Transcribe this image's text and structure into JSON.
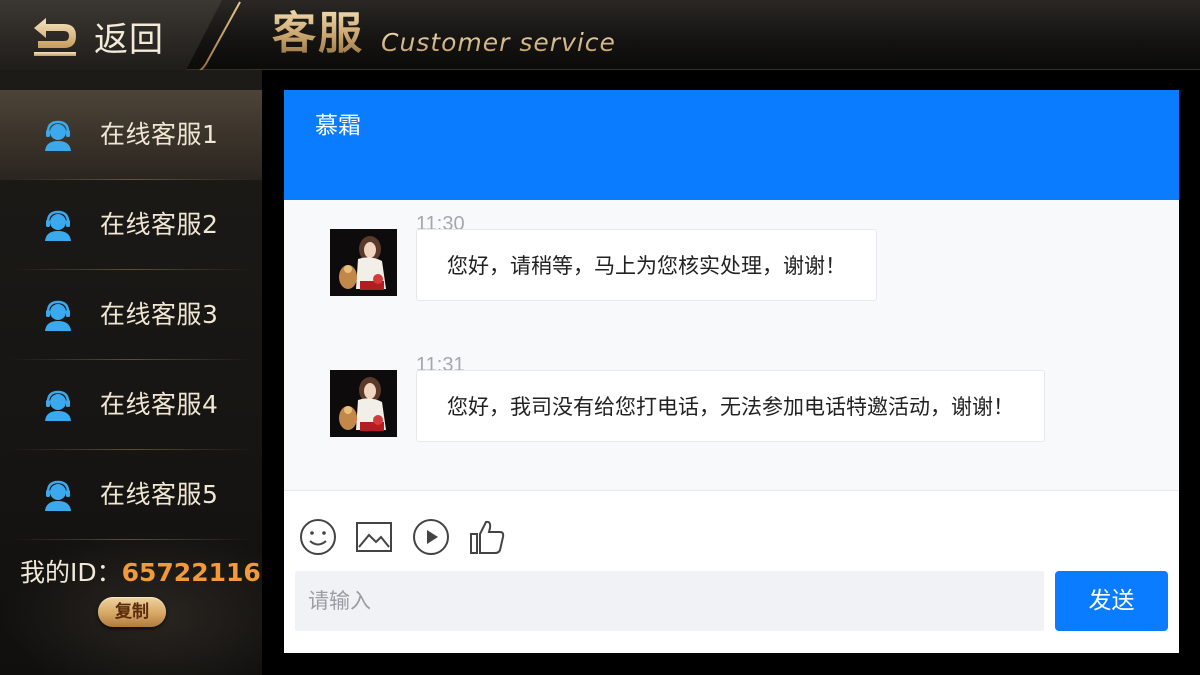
{
  "header": {
    "back_label": "返回",
    "title_cn": "客服",
    "title_en": "Customer service"
  },
  "sidebar": {
    "items": [
      {
        "label": "在线客服1",
        "active": true
      },
      {
        "label": "在线客服2",
        "active": false
      },
      {
        "label": "在线客服3",
        "active": false
      },
      {
        "label": "在线客服4",
        "active": false
      },
      {
        "label": "在线客服5",
        "active": false
      }
    ],
    "id_label": "我的ID：",
    "id_value": "65722116",
    "copy_label": "复制"
  },
  "chat": {
    "title": "慕霜",
    "messages": [
      {
        "time": "11:30",
        "text": "您好，请稍等，马上为您核实处理，谢谢！"
      },
      {
        "time": "11:31",
        "text": "您好，我司没有给您打电话，无法参加电话特邀活动，谢谢！"
      }
    ],
    "toolbar_icons": [
      "emoji-icon",
      "image-icon",
      "video-icon",
      "thumbs-up-icon"
    ],
    "input_placeholder": "请输入",
    "send_label": "发送"
  },
  "colors": {
    "accent_blue": "#0a7cff",
    "gold": "#c8a26a",
    "id_orange": "#f29a3a"
  }
}
